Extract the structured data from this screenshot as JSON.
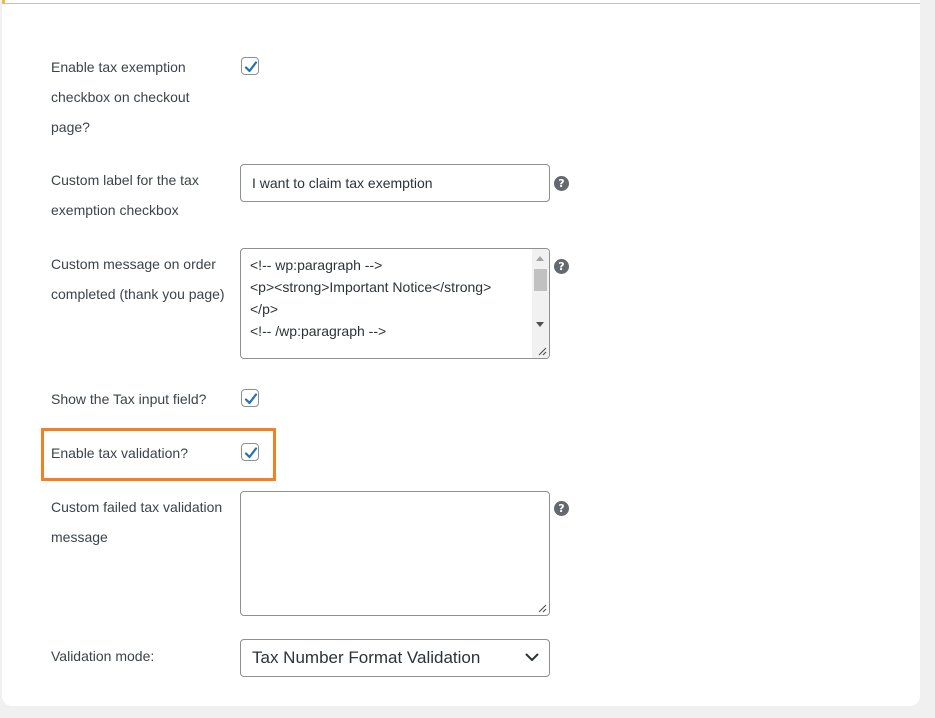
{
  "settings": {
    "tax_exemption_checkbox": {
      "label": "Enable tax exemption checkbox on checkout page?",
      "checked": true
    },
    "custom_label": {
      "label": "Custom label for the tax exemption checkbox",
      "value": "I want to claim tax exemption",
      "help_icon": "question-circle-icon"
    },
    "custom_message": {
      "label": "Custom message on order completed (thank you page)",
      "lines": [
        "<!-- wp:paragraph -->",
        "<p><strong>Important Notice</strong>",
        "</p>",
        "<!-- /wp:paragraph -->"
      ],
      "help_icon": "question-circle-icon"
    },
    "show_tax_input": {
      "label": "Show the Tax input field?",
      "checked": true
    },
    "enable_tax_validation": {
      "label": "Enable tax validation?",
      "checked": true
    },
    "failed_validation_message": {
      "label": "Custom failed tax validation message",
      "value": "",
      "help_icon": "question-circle-icon"
    },
    "validation_mode": {
      "label": "Validation mode:",
      "selected": "Tax Number Format Validation"
    }
  },
  "colors": {
    "checkmark": "#2271b1",
    "highlight": "#f48024",
    "help_icon": "#646970"
  },
  "help_glyph": "?"
}
